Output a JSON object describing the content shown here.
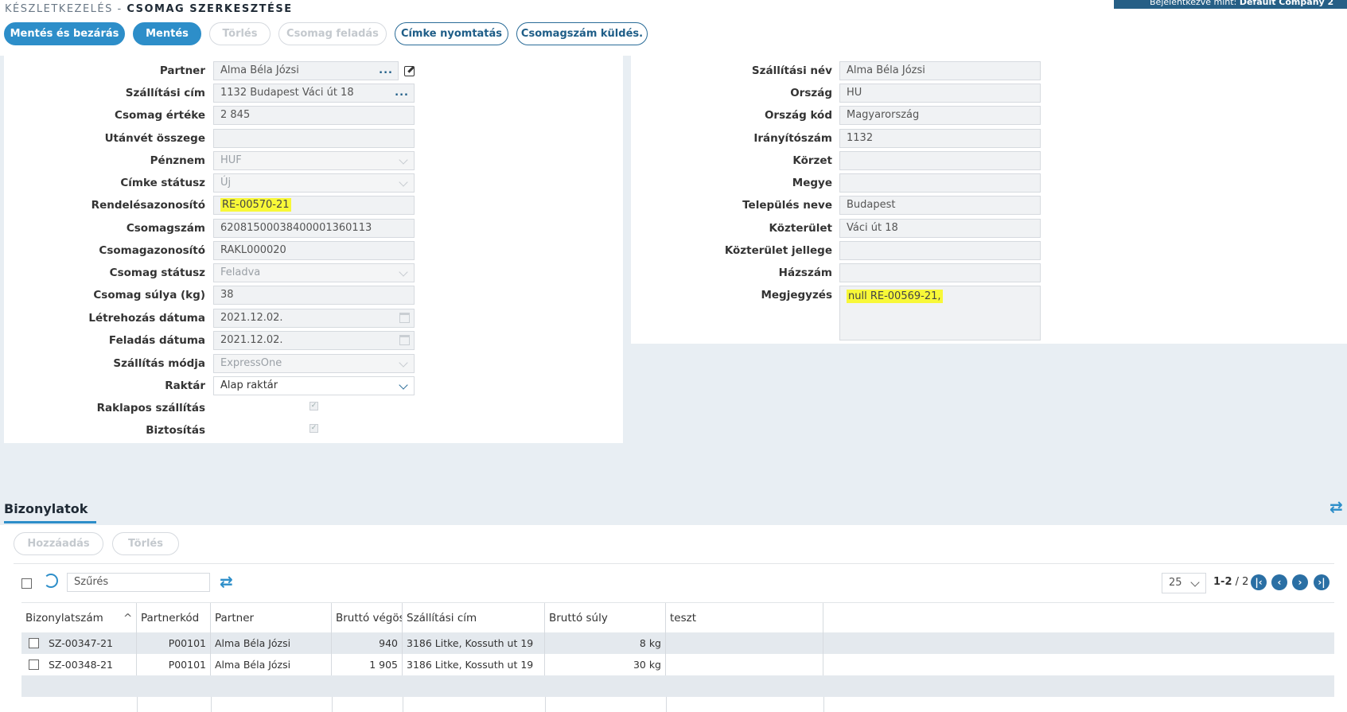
{
  "breadcrumb": {
    "section": "KÉSZLETKEZELÉS -",
    "page": "CSOMAG SZERKESZTÉSE"
  },
  "login": {
    "prefix": "Bejelentkezve mint:",
    "company": "Default Company 2"
  },
  "toolbar": {
    "save_close": "Mentés és bezárás",
    "save": "Mentés",
    "delete": "Törlés",
    "dispatch": "Csomag feladás",
    "print_label": "Címke nyomtatás",
    "send_number": "Csomagszám küldés."
  },
  "left_form": {
    "partner": {
      "label": "Partner",
      "value": "Alma Béla Józsi"
    },
    "shipping_address": {
      "label": "Szállítási cím",
      "value": "1132 Budapest Váci út 18"
    },
    "package_value": {
      "label": "Csomag értéke",
      "value": "2 845"
    },
    "cod_amount": {
      "label": "Utánvét összege",
      "value": ""
    },
    "currency": {
      "label": "Pénznem",
      "value": "HUF"
    },
    "label_status": {
      "label": "Címke státusz",
      "value": "Új"
    },
    "order_id": {
      "label": "Rendelésazonosító",
      "value": "RE-00570-21"
    },
    "package_number": {
      "label": "Csomagszám",
      "value": "62081500038400001360113"
    },
    "package_id": {
      "label": "Csomagazonosító",
      "value": "RAKL000020"
    },
    "package_status": {
      "label": "Csomag státusz",
      "value": "Feladva"
    },
    "package_weight": {
      "label": "Csomag súlya (kg)",
      "value": "38"
    },
    "created_date": {
      "label": "Létrehozás dátuma",
      "value": "2021.12.02."
    },
    "dispatch_date": {
      "label": "Feladás dátuma",
      "value": "2021.12.02."
    },
    "shipping_method": {
      "label": "Szállítás módja",
      "value": "ExpressOne"
    },
    "warehouse": {
      "label": "Raktár",
      "value": "Alap raktár"
    },
    "pallet_shipping": {
      "label": "Raklapos szállítás",
      "checked": true
    },
    "insurance": {
      "label": "Biztosítás",
      "checked": true
    }
  },
  "right_form": {
    "shipping_name": {
      "label": "Szállítási név",
      "value": "Alma Béla Józsi"
    },
    "country": {
      "label": "Ország",
      "value": "HU"
    },
    "country_code": {
      "label": "Ország kód",
      "value": "Magyarország"
    },
    "zip": {
      "label": "Irányítószám",
      "value": "1132"
    },
    "district": {
      "label": "Körzet",
      "value": ""
    },
    "county": {
      "label": "Megye",
      "value": ""
    },
    "city": {
      "label": "Település neve",
      "value": "Budapest"
    },
    "street": {
      "label": "Közterület",
      "value": "Váci út 18"
    },
    "street_type": {
      "label": "Közterület jellege",
      "value": ""
    },
    "house_number": {
      "label": "Házszám",
      "value": ""
    },
    "note": {
      "label": "Megjegyzés",
      "value": "null RE-00569-21,"
    }
  },
  "documents": {
    "tab": "Bizonylatok",
    "add": "Hozzáadás",
    "delete": "Törlés",
    "filter_placeholder": "Szűrés",
    "page_size": "25",
    "page_range": "1-2",
    "page_total": "/ 2",
    "columns": [
      "Bizonylatszám",
      "Partnerkód",
      "Partner",
      "Bruttó végös",
      "Szállítási cím",
      "Bruttó súly",
      "teszt"
    ],
    "rows": [
      [
        "SZ-00347-21",
        "P00101",
        "Alma Béla Józsi",
        "940",
        "3186 Litke, Kossuth ut 19",
        "8 kg",
        ""
      ],
      [
        "SZ-00348-21",
        "P00101",
        "Alma Béla Józsi",
        "1 905",
        "3186 Litke, Kossuth ut 19",
        "30 kg",
        ""
      ]
    ]
  },
  "colors": {
    "primary": "#2d8ec9",
    "dark_blue": "#265f86",
    "highlight": "#f8f838"
  }
}
